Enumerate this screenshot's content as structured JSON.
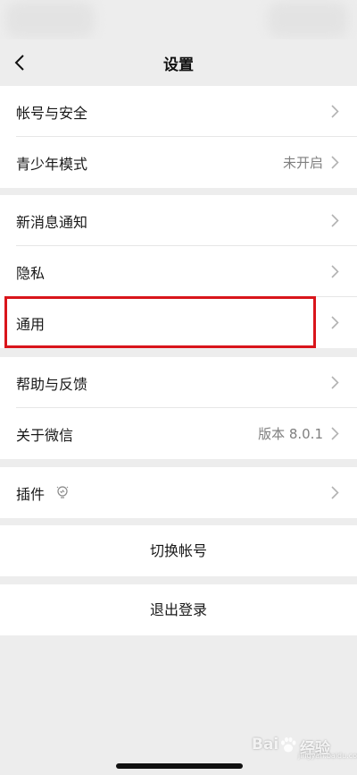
{
  "nav": {
    "title": "设置"
  },
  "groups": [
    {
      "items": [
        {
          "label": "帐号与安全",
          "value": ""
        },
        {
          "label": "青少年模式",
          "value": "未开启"
        }
      ]
    },
    {
      "items": [
        {
          "label": "新消息通知",
          "value": ""
        },
        {
          "label": "隐私",
          "value": ""
        },
        {
          "label": "通用",
          "value": ""
        }
      ]
    },
    {
      "items": [
        {
          "label": "帮助与反馈",
          "value": ""
        },
        {
          "label": "关于微信",
          "value": "版本 8.0.1"
        }
      ]
    },
    {
      "items": [
        {
          "label": "插件",
          "value": ""
        }
      ]
    }
  ],
  "actions": {
    "switch_account": "切换帐号",
    "logout": "退出登录"
  },
  "watermark": {
    "brand_left": "Bai",
    "brand_right": "经验",
    "brand_suffix": "",
    "subtitle": "jingyan.baidu.com"
  },
  "colors": {
    "highlight": "#d9151b",
    "background": "#ededed",
    "chevron": "#b2b2b2"
  }
}
